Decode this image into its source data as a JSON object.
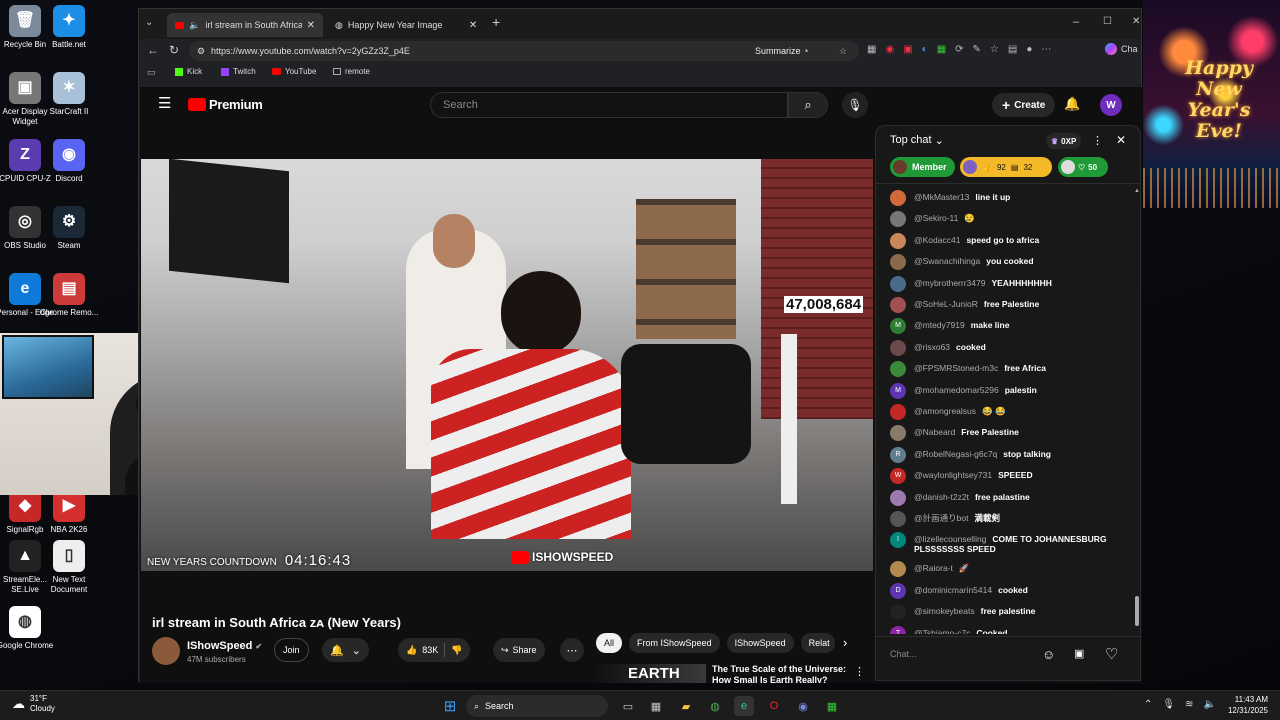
{
  "desktop": {
    "icons": [
      {
        "label": "Recycle Bin",
        "glyph": "🗑"
      },
      {
        "label": "Battle.net",
        "glyph": "✦"
      },
      {
        "label": "Acer Display Widget",
        "glyph": "▣"
      },
      {
        "label": "StarCraft II",
        "glyph": "✶"
      },
      {
        "label": "CPUID CPU-Z",
        "glyph": "Z"
      },
      {
        "label": "Discord",
        "glyph": "◉"
      },
      {
        "label": "OBS Studio",
        "glyph": "◎"
      },
      {
        "label": "Steam",
        "glyph": "⚙"
      },
      {
        "label": "Personal - Edge",
        "glyph": "e"
      },
      {
        "label": "Chrome Remo...",
        "glyph": "▤"
      },
      {
        "label": "SignalRgb",
        "glyph": "◆"
      },
      {
        "label": "NBA 2K26",
        "glyph": "▶"
      },
      {
        "label": "StreamEle... SE.Live",
        "glyph": "▲"
      },
      {
        "label": "New Text Document",
        "glyph": "▯"
      },
      {
        "label": "Google Chrome",
        "glyph": "◍"
      }
    ],
    "newyear_image_text": "Happy New Year's Eve!"
  },
  "browser": {
    "tabs": [
      {
        "title": "irl stream in South Africa ᴢᴀ (",
        "active": true
      },
      {
        "title": "Happy New Year Image",
        "active": false
      }
    ],
    "url": "https://www.youtube.com/watch?v=2yGZz3Z_p4E",
    "summarize_label": "Summarize",
    "profile_label": "Cha",
    "bookmarks": [
      {
        "label": "Kick",
        "color": "#53fc18"
      },
      {
        "label": "Twitch",
        "color": "#9146ff"
      },
      {
        "label": "YouTube",
        "color": "#ff0000"
      },
      {
        "label": "remote",
        "color": "#aaaaaa"
      }
    ]
  },
  "youtube": {
    "logo_text": "Premium",
    "search_placeholder": "Search",
    "create_label": "Create",
    "avatar_letter": "W",
    "video": {
      "view_count": "47,008,684",
      "countdown_label": "NEW YEARS COUNTDOWN",
      "countdown_time": "04:16:43",
      "watermark": "ISHOWSPEED"
    },
    "title": "irl stream in South Africa ᴢᴀ (New Years)",
    "channel": "IShowSpeed",
    "subscribers": "47M subscribers",
    "join_label": "Join",
    "likes": "83K",
    "share_label": "Share",
    "chips": [
      "All",
      "From IShowSpeed",
      "IShowSpeed",
      "Relat"
    ],
    "next_video_title": "The True Scale of the Universe: How Small Is Earth Really?",
    "next_video_thumb_text": "EARTH"
  },
  "chat": {
    "header": "Top chat",
    "xp_label": "0XP",
    "member_label": "Member",
    "stat_a": "92",
    "stat_b": "32",
    "stat_c": "50",
    "input_placeholder": "Chat...",
    "messages": [
      {
        "author": "@MkMaster13",
        "text": "line it up",
        "av": "#d06a3a"
      },
      {
        "author": "@Sekiro-11",
        "text": "😢",
        "av": "#777777"
      },
      {
        "author": "@Kodacc41",
        "text": "speed go to africa",
        "av": "#c9875a"
      },
      {
        "author": "@Swanachihinga",
        "text": "you cooked",
        "av": "#8a6a4a"
      },
      {
        "author": "@mybrotherrr3479",
        "text": "YEAHHHHHHH",
        "av": "#4a6a8a"
      },
      {
        "author": "@SoHeL-JunioR",
        "text": "free Palestine",
        "av": "#a05050"
      },
      {
        "author": "@mtedy7919",
        "text": "make line",
        "av": "#2e7d32",
        "letter": "M"
      },
      {
        "author": "@risxo63",
        "text": "cooked",
        "av": "#6a4a4a"
      },
      {
        "author": "@FPSMRStoned-m3c",
        "text": "free Africa",
        "av": "#3a8a3a"
      },
      {
        "author": "@mohamedomar5296",
        "text": "palestin",
        "av": "#5e35b1",
        "letter": "M"
      },
      {
        "author": "@amongrealsus",
        "text": "😂 😂",
        "av": "#c62828"
      },
      {
        "author": "@Nabeard",
        "text": "Free Palestine",
        "av": "#8a7a6a"
      },
      {
        "author": "@RobelNegasi-g6c7q",
        "text": "stop talking",
        "av": "#607d8b",
        "letter": "R"
      },
      {
        "author": "@waylonlightsey731",
        "text": "SPEEED",
        "av": "#c62828",
        "letter": "W"
      },
      {
        "author": "@danish-t2z2t",
        "text": "free palastine",
        "av": "#9c7ab0"
      },
      {
        "author": "@計画通りbot",
        "text": "満載剣",
        "av": "#555555"
      },
      {
        "author": "@lizellecounselling",
        "text": "COME TO JOHANNESBURG PLSSSSSSS SPEED",
        "av": "#00897b",
        "letter": "I"
      },
      {
        "author": "@Raiora-t",
        "text": "🚀",
        "av": "#b08a50"
      },
      {
        "author": "@dominicmarin5414",
        "text": "cooked",
        "av": "#5e35b1",
        "letter": "D"
      },
      {
        "author": "@simokeybeats",
        "text": "free palestine",
        "av": "#222222"
      },
      {
        "author": "@Tshiamo-c7c",
        "text": "Cooked",
        "av": "#8e24aa",
        "letter": "T"
      }
    ]
  },
  "taskbar": {
    "weather_temp": "31°F",
    "weather_desc": "Cloudy",
    "search_label": "Search",
    "time": "11:43 AM",
    "date": "12/31/2025"
  }
}
